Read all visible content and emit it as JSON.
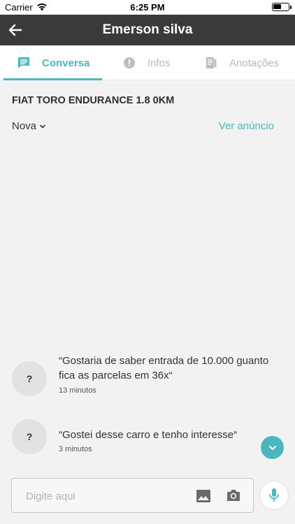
{
  "status_bar": {
    "carrier": "Carrier",
    "time": "6:25 PM"
  },
  "header": {
    "title": "Emerson silva",
    "back_icon": "arrow-left-icon",
    "background": "#3a3a3a"
  },
  "tabs": [
    {
      "label": "Conversa",
      "icon": "chat-icon",
      "active": true
    },
    {
      "label": "Infos",
      "icon": "alert-circle-icon",
      "active": false
    },
    {
      "label": "Anotações",
      "icon": "notes-icon",
      "active": false
    }
  ],
  "listing": {
    "title": "FIAT TORO ENDURANCE 1.8 0KM",
    "condition": "Nova",
    "see_ad_label": "Ver anúncio"
  },
  "messages": [
    {
      "avatar": "?",
      "text": "“Gostaria de saber entrada de 10.000 guanto fica as parcelas em 36x“",
      "time": "13 minutos"
    },
    {
      "avatar": "?",
      "text": "“Gostei desse carro e tenho interesse“",
      "time": "3 minutos"
    }
  ],
  "composer": {
    "placeholder": "Digite aqui",
    "value": "",
    "image_icon": "image-icon",
    "camera_icon": "camera-icon",
    "mic_icon": "microphone-icon"
  },
  "colors": {
    "accent": "#4cb6bd",
    "header": "#3a3a3a",
    "background": "#f2f2f2"
  }
}
